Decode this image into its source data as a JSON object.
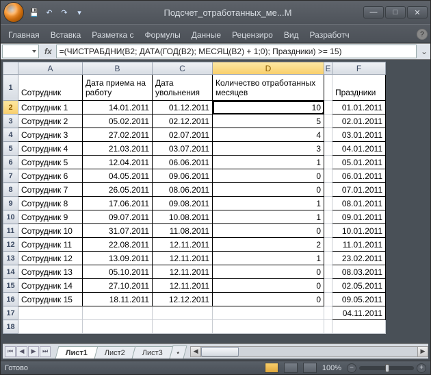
{
  "window": {
    "title": "Подсчет_отработанных_ме...M",
    "qat_items": [
      "save-icon",
      "undo-icon",
      "redo-icon",
      "dropdown-icon"
    ]
  },
  "ribbon": {
    "tabs": [
      "Главная",
      "Вставка",
      "Разметка с",
      "Формулы",
      "Данные",
      "Рецензиро",
      "Вид",
      "Разработч"
    ]
  },
  "formula_bar": {
    "name_box": "",
    "fx_label": "fx",
    "formula": "=(ЧИСТРАБДНИ(B2; ДАТА(ГОД(B2); МЕСЯЦ(B2) + 1;0); Праздники) >= 15)"
  },
  "columns": [
    "A",
    "B",
    "C",
    "D",
    "E",
    "F"
  ],
  "headers": {
    "A": "Сотрудник",
    "B": "Дата приема на работу",
    "C": "Дата увольнения",
    "D": "Количество отработанных  месяцев",
    "F": "Праздники"
  },
  "active_cell": {
    "row": 2,
    "col": "D"
  },
  "rows": [
    {
      "n": 2,
      "A": "Сотрудник 1",
      "B": "14.01.2011",
      "C": "01.12.2011",
      "D": "10",
      "F": "01.01.2011"
    },
    {
      "n": 3,
      "A": "Сотрудник 2",
      "B": "05.02.2011",
      "C": "02.12.2011",
      "D": "5",
      "F": "02.01.2011"
    },
    {
      "n": 4,
      "A": "Сотрудник 3",
      "B": "27.02.2011",
      "C": "02.07.2011",
      "D": "4",
      "F": "03.01.2011"
    },
    {
      "n": 5,
      "A": "Сотрудник 4",
      "B": "21.03.2011",
      "C": "03.07.2011",
      "D": "3",
      "F": "04.01.2011"
    },
    {
      "n": 6,
      "A": "Сотрудник 5",
      "B": "12.04.2011",
      "C": "06.06.2011",
      "D": "1",
      "F": "05.01.2011"
    },
    {
      "n": 7,
      "A": "Сотрудник 6",
      "B": "04.05.2011",
      "C": "09.06.2011",
      "D": "0",
      "F": "06.01.2011"
    },
    {
      "n": 8,
      "A": "Сотрудник 7",
      "B": "26.05.2011",
      "C": "08.06.2011",
      "D": "0",
      "F": "07.01.2011"
    },
    {
      "n": 9,
      "A": "Сотрудник 8",
      "B": "17.06.2011",
      "C": "09.08.2011",
      "D": "1",
      "F": "08.01.2011"
    },
    {
      "n": 10,
      "A": "Сотрудник 9",
      "B": "09.07.2011",
      "C": "10.08.2011",
      "D": "1",
      "F": "09.01.2011"
    },
    {
      "n": 11,
      "A": "Сотрудник 10",
      "B": "31.07.2011",
      "C": "11.08.2011",
      "D": "0",
      "F": "10.01.2011"
    },
    {
      "n": 12,
      "A": "Сотрудник 11",
      "B": "22.08.2011",
      "C": "12.11.2011",
      "D": "2",
      "F": "11.01.2011"
    },
    {
      "n": 13,
      "A": "Сотрудник 12",
      "B": "13.09.2011",
      "C": "12.11.2011",
      "D": "1",
      "F": "23.02.2011"
    },
    {
      "n": 14,
      "A": "Сотрудник 13",
      "B": "05.10.2011",
      "C": "12.11.2011",
      "D": "0",
      "F": "08.03.2011"
    },
    {
      "n": 15,
      "A": "Сотрудник 14",
      "B": "27.10.2011",
      "C": "12.11.2011",
      "D": "0",
      "F": "02.05.2011"
    },
    {
      "n": 16,
      "A": "Сотрудник 15",
      "B": "18.11.2011",
      "C": "12.12.2011",
      "D": "0",
      "F": "09.05.2011"
    },
    {
      "n": 17,
      "A": "",
      "B": "",
      "C": "",
      "D": "",
      "F": "04.11.2011"
    },
    {
      "n": 18,
      "A": "",
      "B": "",
      "C": "",
      "D": "",
      "F": ""
    }
  ],
  "sheet_tabs": {
    "active": "Лист1",
    "tabs": [
      "Лист1",
      "Лист2",
      "Лист3"
    ]
  },
  "status": {
    "text": "Готово",
    "zoom": "100%"
  }
}
